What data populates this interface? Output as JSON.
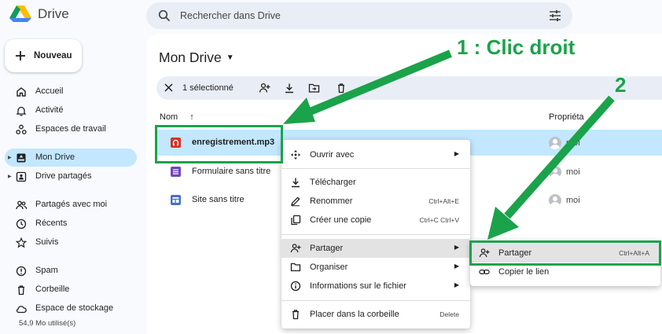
{
  "app": {
    "title": "Drive"
  },
  "search": {
    "placeholder": "Rechercher dans Drive"
  },
  "sidebar": {
    "new_label": "Nouveau",
    "items": [
      {
        "label": "Accueil",
        "icon": "home-icon"
      },
      {
        "label": "Activité",
        "icon": "bell-icon"
      },
      {
        "label": "Espaces de travail",
        "icon": "workspaces-icon"
      },
      {
        "label": "Mon Drive",
        "icon": "drive-icon",
        "active": true
      },
      {
        "label": "Drive partagés",
        "icon": "shared-drives-icon"
      },
      {
        "label": "Partagés avec moi",
        "icon": "people-icon"
      },
      {
        "label": "Récents",
        "icon": "clock-icon"
      },
      {
        "label": "Suivis",
        "icon": "star-icon"
      },
      {
        "label": "Spam",
        "icon": "spam-icon"
      },
      {
        "label": "Corbeille",
        "icon": "trash-icon"
      },
      {
        "label": "Espace de stockage",
        "icon": "cloud-icon"
      }
    ],
    "storage_used": "54,9 Mo utilisé(s)"
  },
  "main": {
    "title": "Mon Drive",
    "selection": {
      "count_label": "1 sélectionné"
    },
    "columns": {
      "name": "Nom",
      "owner": "Propriéta"
    },
    "files": [
      {
        "name": "enregistrement.mp3",
        "owner": "moi",
        "type": "audio",
        "color": "#d93025",
        "selected": true
      },
      {
        "name": "Formulaire sans titre",
        "owner": "moi",
        "type": "form",
        "color": "#7248b9"
      },
      {
        "name": "Site sans titre",
        "owner": "moi",
        "type": "site",
        "color": "#4b6fc5"
      }
    ]
  },
  "context_menu": {
    "items": [
      {
        "label": "Ouvrir avec",
        "icon": "open-with-icon",
        "submenu": true
      },
      {
        "label": "Télécharger",
        "icon": "download-icon"
      },
      {
        "label": "Renommer",
        "icon": "rename-icon",
        "shortcut": "Ctrl+Alt+E"
      },
      {
        "label": "Créer une copie",
        "icon": "copy-icon",
        "shortcut": "Ctrl+C Ctrl+V"
      },
      {
        "label": "Partager",
        "icon": "share-icon",
        "submenu": true,
        "hover": true
      },
      {
        "label": "Organiser",
        "icon": "folder-icon",
        "submenu": true
      },
      {
        "label": "Informations sur le fichier",
        "icon": "info-icon",
        "submenu": true
      },
      {
        "label": "Placer dans la corbeille",
        "icon": "trash-icon",
        "shortcut": "Delete"
      }
    ]
  },
  "share_submenu": {
    "items": [
      {
        "label": "Partager",
        "icon": "share-icon",
        "shortcut": "Ctrl+Alt+A",
        "hover": true
      },
      {
        "label": "Copier le lien",
        "icon": "link-icon"
      }
    ]
  },
  "annotations": {
    "step1": "1 : Clic droit",
    "step2": "2",
    "color": "#1aa34a"
  }
}
